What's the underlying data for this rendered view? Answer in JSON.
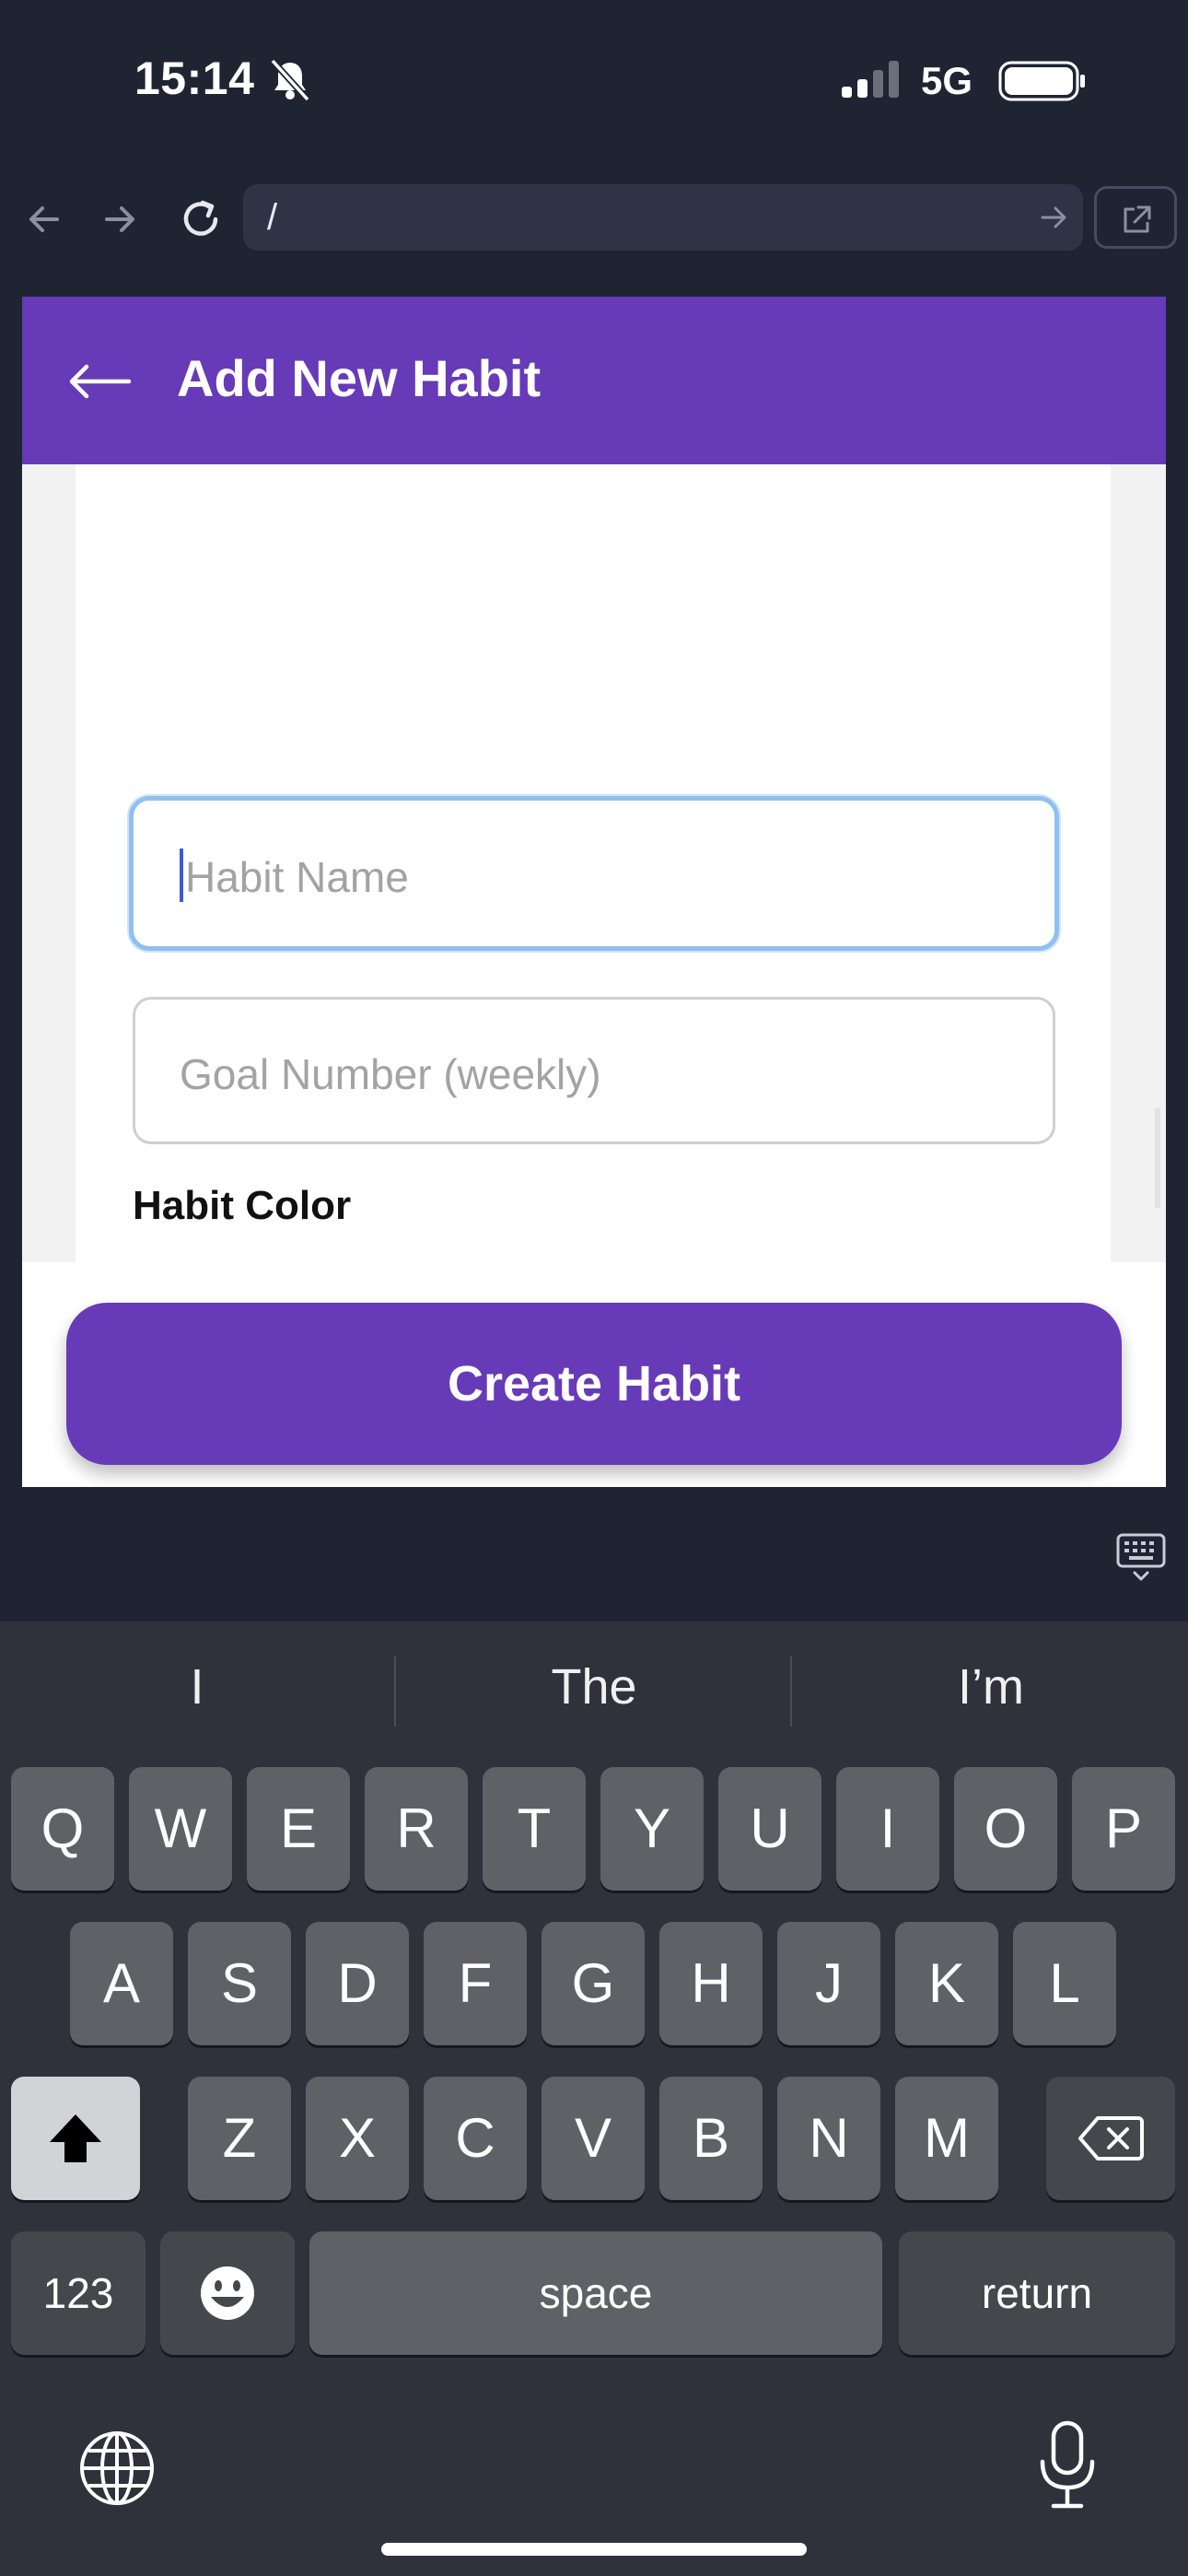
{
  "status_bar": {
    "time": "15:14",
    "network": "5G",
    "icons": [
      "bell-slash-icon",
      "signal-bars-icon",
      "battery-icon"
    ]
  },
  "browser": {
    "url": "/",
    "buttons": [
      "back-icon",
      "forward-icon",
      "reload-icon",
      "go-icon",
      "open-external-icon"
    ]
  },
  "header": {
    "back_icon": "left-arrow-icon",
    "title": "Add New Habit"
  },
  "form": {
    "habit_name": {
      "value": "",
      "placeholder": "Habit Name"
    },
    "goal_number": {
      "value": "",
      "placeholder": "Goal Number (weekly)"
    },
    "habit_color_label": "Habit Color"
  },
  "footer": {
    "create_label": "Create Habit"
  },
  "keyboard": {
    "suggestions": [
      "I",
      "The",
      "I’m"
    ],
    "rows": [
      [
        "Q",
        "W",
        "E",
        "R",
        "T",
        "Y",
        "U",
        "I",
        "O",
        "P"
      ],
      [
        "A",
        "S",
        "D",
        "F",
        "G",
        "H",
        "J",
        "K",
        "L"
      ],
      [
        "Z",
        "X",
        "C",
        "V",
        "B",
        "N",
        "M"
      ]
    ],
    "numbers_label": "123",
    "space_label": "space",
    "return_label": "return",
    "icons": [
      "shift-icon",
      "backspace-icon",
      "emoji-icon",
      "globe-icon",
      "mic-icon",
      "keyboard-hide-icon"
    ]
  },
  "colors": {
    "accent": "#673ab7",
    "focus_border": "#90c0f0",
    "chrome": "#1f2433",
    "keyboard": "#2f323a"
  }
}
